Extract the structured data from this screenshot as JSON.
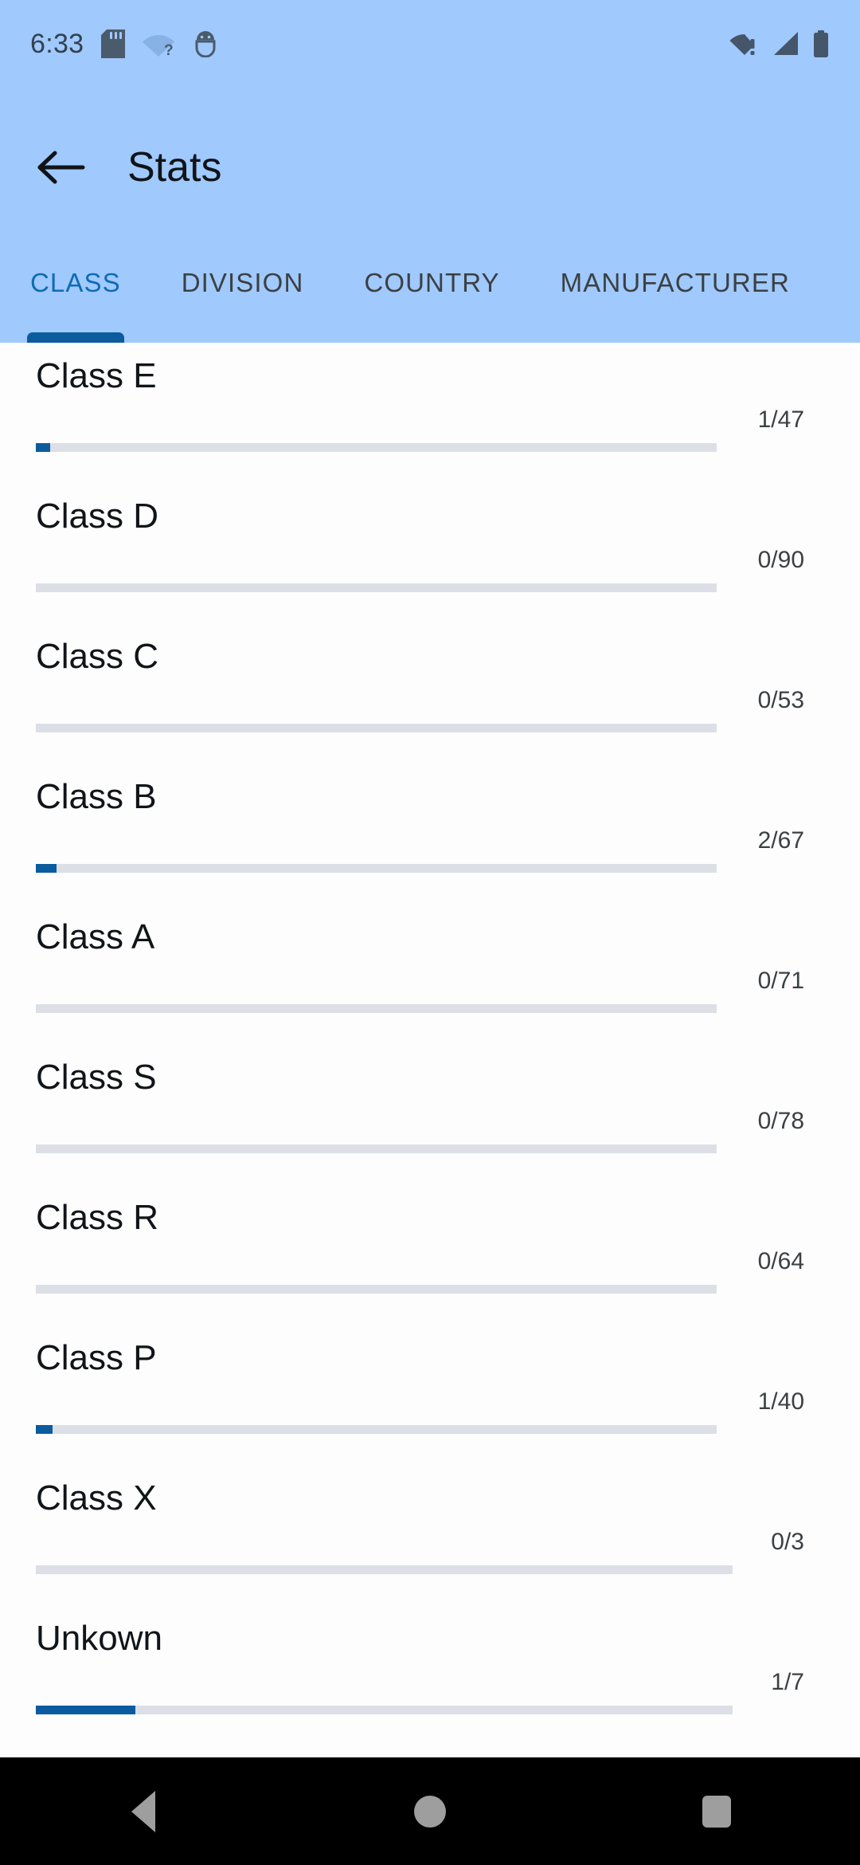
{
  "status_bar": {
    "time": "6:33",
    "left_icons": [
      "sd-card-icon",
      "wifi-unknown-icon",
      "android-debug-icon"
    ],
    "right_icons": [
      "wifi-alert-icon",
      "cell-signal-icon",
      "battery-full-icon"
    ],
    "text_color": "#33414f"
  },
  "app_bar": {
    "background": "#a0c9fd",
    "back_icon": "arrow-back-icon",
    "title": "Stats"
  },
  "tabs": {
    "active_index": 0,
    "active_color": "#0f6cb3",
    "indicator_color": "#0b5c9e",
    "inactive_color": "#3c4043",
    "items": [
      {
        "label": "CLASS"
      },
      {
        "label": "DIVISION"
      },
      {
        "label": "COUNTRY"
      },
      {
        "label": "MANUFACTURER"
      }
    ]
  },
  "list": {
    "track_color": "#dcdfe6",
    "fill_color": "#0b5c9e",
    "rows": [
      {
        "label": "Class E",
        "count": "1/47",
        "collected": 1,
        "total": 47,
        "percent": 2.1
      },
      {
        "label": "Class D",
        "count": "0/90",
        "collected": 0,
        "total": 90,
        "percent": 0
      },
      {
        "label": "Class C",
        "count": "0/53",
        "collected": 0,
        "total": 53,
        "percent": 0
      },
      {
        "label": "Class B",
        "count": "2/67",
        "collected": 2,
        "total": 67,
        "percent": 3.0
      },
      {
        "label": "Class A",
        "count": "0/71",
        "collected": 0,
        "total": 71,
        "percent": 0
      },
      {
        "label": "Class S",
        "count": "0/78",
        "collected": 0,
        "total": 78,
        "percent": 0
      },
      {
        "label": "Class R",
        "count": "0/64",
        "collected": 0,
        "total": 64,
        "percent": 0
      },
      {
        "label": "Class P",
        "count": "1/40",
        "collected": 1,
        "total": 40,
        "percent": 2.5
      },
      {
        "label": "Class X",
        "count": "0/3",
        "collected": 0,
        "total": 3,
        "percent": 0
      },
      {
        "label": "Unkown",
        "count": "1/7",
        "collected": 1,
        "total": 7,
        "percent": 14.3
      }
    ]
  },
  "nav_bar": {
    "background": "#000000",
    "buttons": [
      {
        "name": "back",
        "icon": "triangle-back-icon"
      },
      {
        "name": "home",
        "icon": "circle-home-icon"
      },
      {
        "name": "recents",
        "icon": "square-recents-icon"
      }
    ]
  }
}
